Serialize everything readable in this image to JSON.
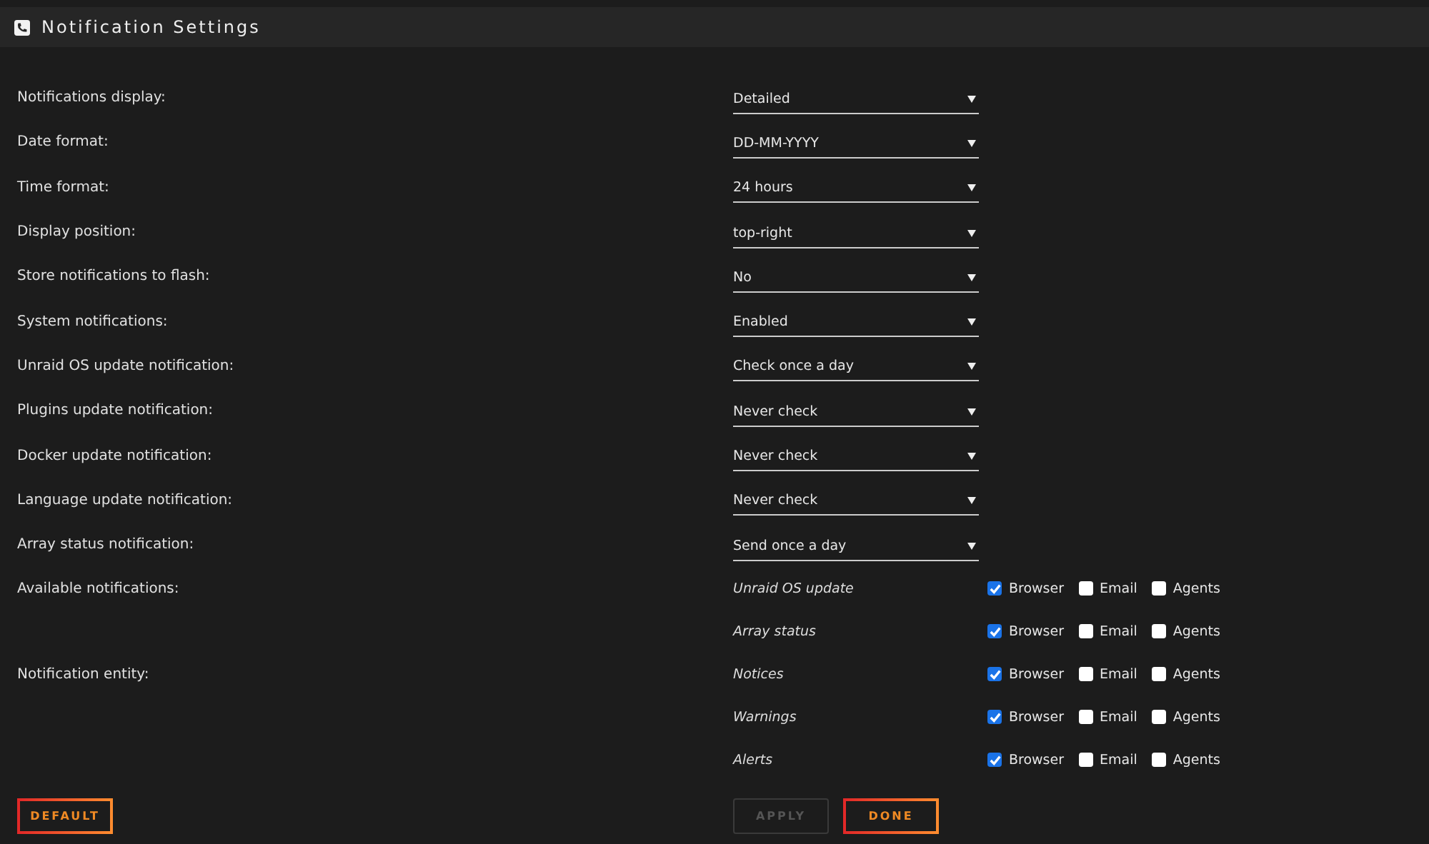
{
  "title": "Notification Settings",
  "settings": [
    {
      "label": "Notifications display:",
      "value": "Detailed"
    },
    {
      "label": "Date format:",
      "value": "DD-MM-YYYY"
    },
    {
      "label": "Time format:",
      "value": "24 hours"
    },
    {
      "label": "Display position:",
      "value": "top-right"
    },
    {
      "label": "Store notifications to flash:",
      "value": "No"
    },
    {
      "label": "System notifications:",
      "value": "Enabled"
    },
    {
      "label": "Unraid OS update notification:",
      "value": "Check once a day"
    },
    {
      "label": "Plugins update notification:",
      "value": "Never check"
    },
    {
      "label": "Docker update notification:",
      "value": "Never check"
    },
    {
      "label": "Language update notification:",
      "value": "Never check"
    },
    {
      "label": "Array status notification:",
      "value": "Send once a day"
    }
  ],
  "groups": [
    {
      "label": "Available notifications:",
      "rows": [
        {
          "name": "Unraid OS update",
          "options": [
            {
              "label": "Browser",
              "checked": true
            },
            {
              "label": "Email",
              "checked": false
            },
            {
              "label": "Agents",
              "checked": false
            }
          ]
        },
        {
          "name": "Array status",
          "options": [
            {
              "label": "Browser",
              "checked": true
            },
            {
              "label": "Email",
              "checked": false
            },
            {
              "label": "Agents",
              "checked": false
            }
          ]
        }
      ]
    },
    {
      "label": "Notification entity:",
      "rows": [
        {
          "name": "Notices",
          "options": [
            {
              "label": "Browser",
              "checked": true
            },
            {
              "label": "Email",
              "checked": false
            },
            {
              "label": "Agents",
              "checked": false
            }
          ]
        },
        {
          "name": "Warnings",
          "options": [
            {
              "label": "Browser",
              "checked": true
            },
            {
              "label": "Email",
              "checked": false
            },
            {
              "label": "Agents",
              "checked": false
            }
          ]
        },
        {
          "name": "Alerts",
          "options": [
            {
              "label": "Browser",
              "checked": true
            },
            {
              "label": "Email",
              "checked": false
            },
            {
              "label": "Agents",
              "checked": false
            }
          ]
        }
      ]
    }
  ],
  "buttons": [
    {
      "label": "DEFAULT",
      "disabled": false
    },
    {
      "label": "APPLY",
      "disabled": true
    },
    {
      "label": "DONE",
      "disabled": false
    }
  ]
}
